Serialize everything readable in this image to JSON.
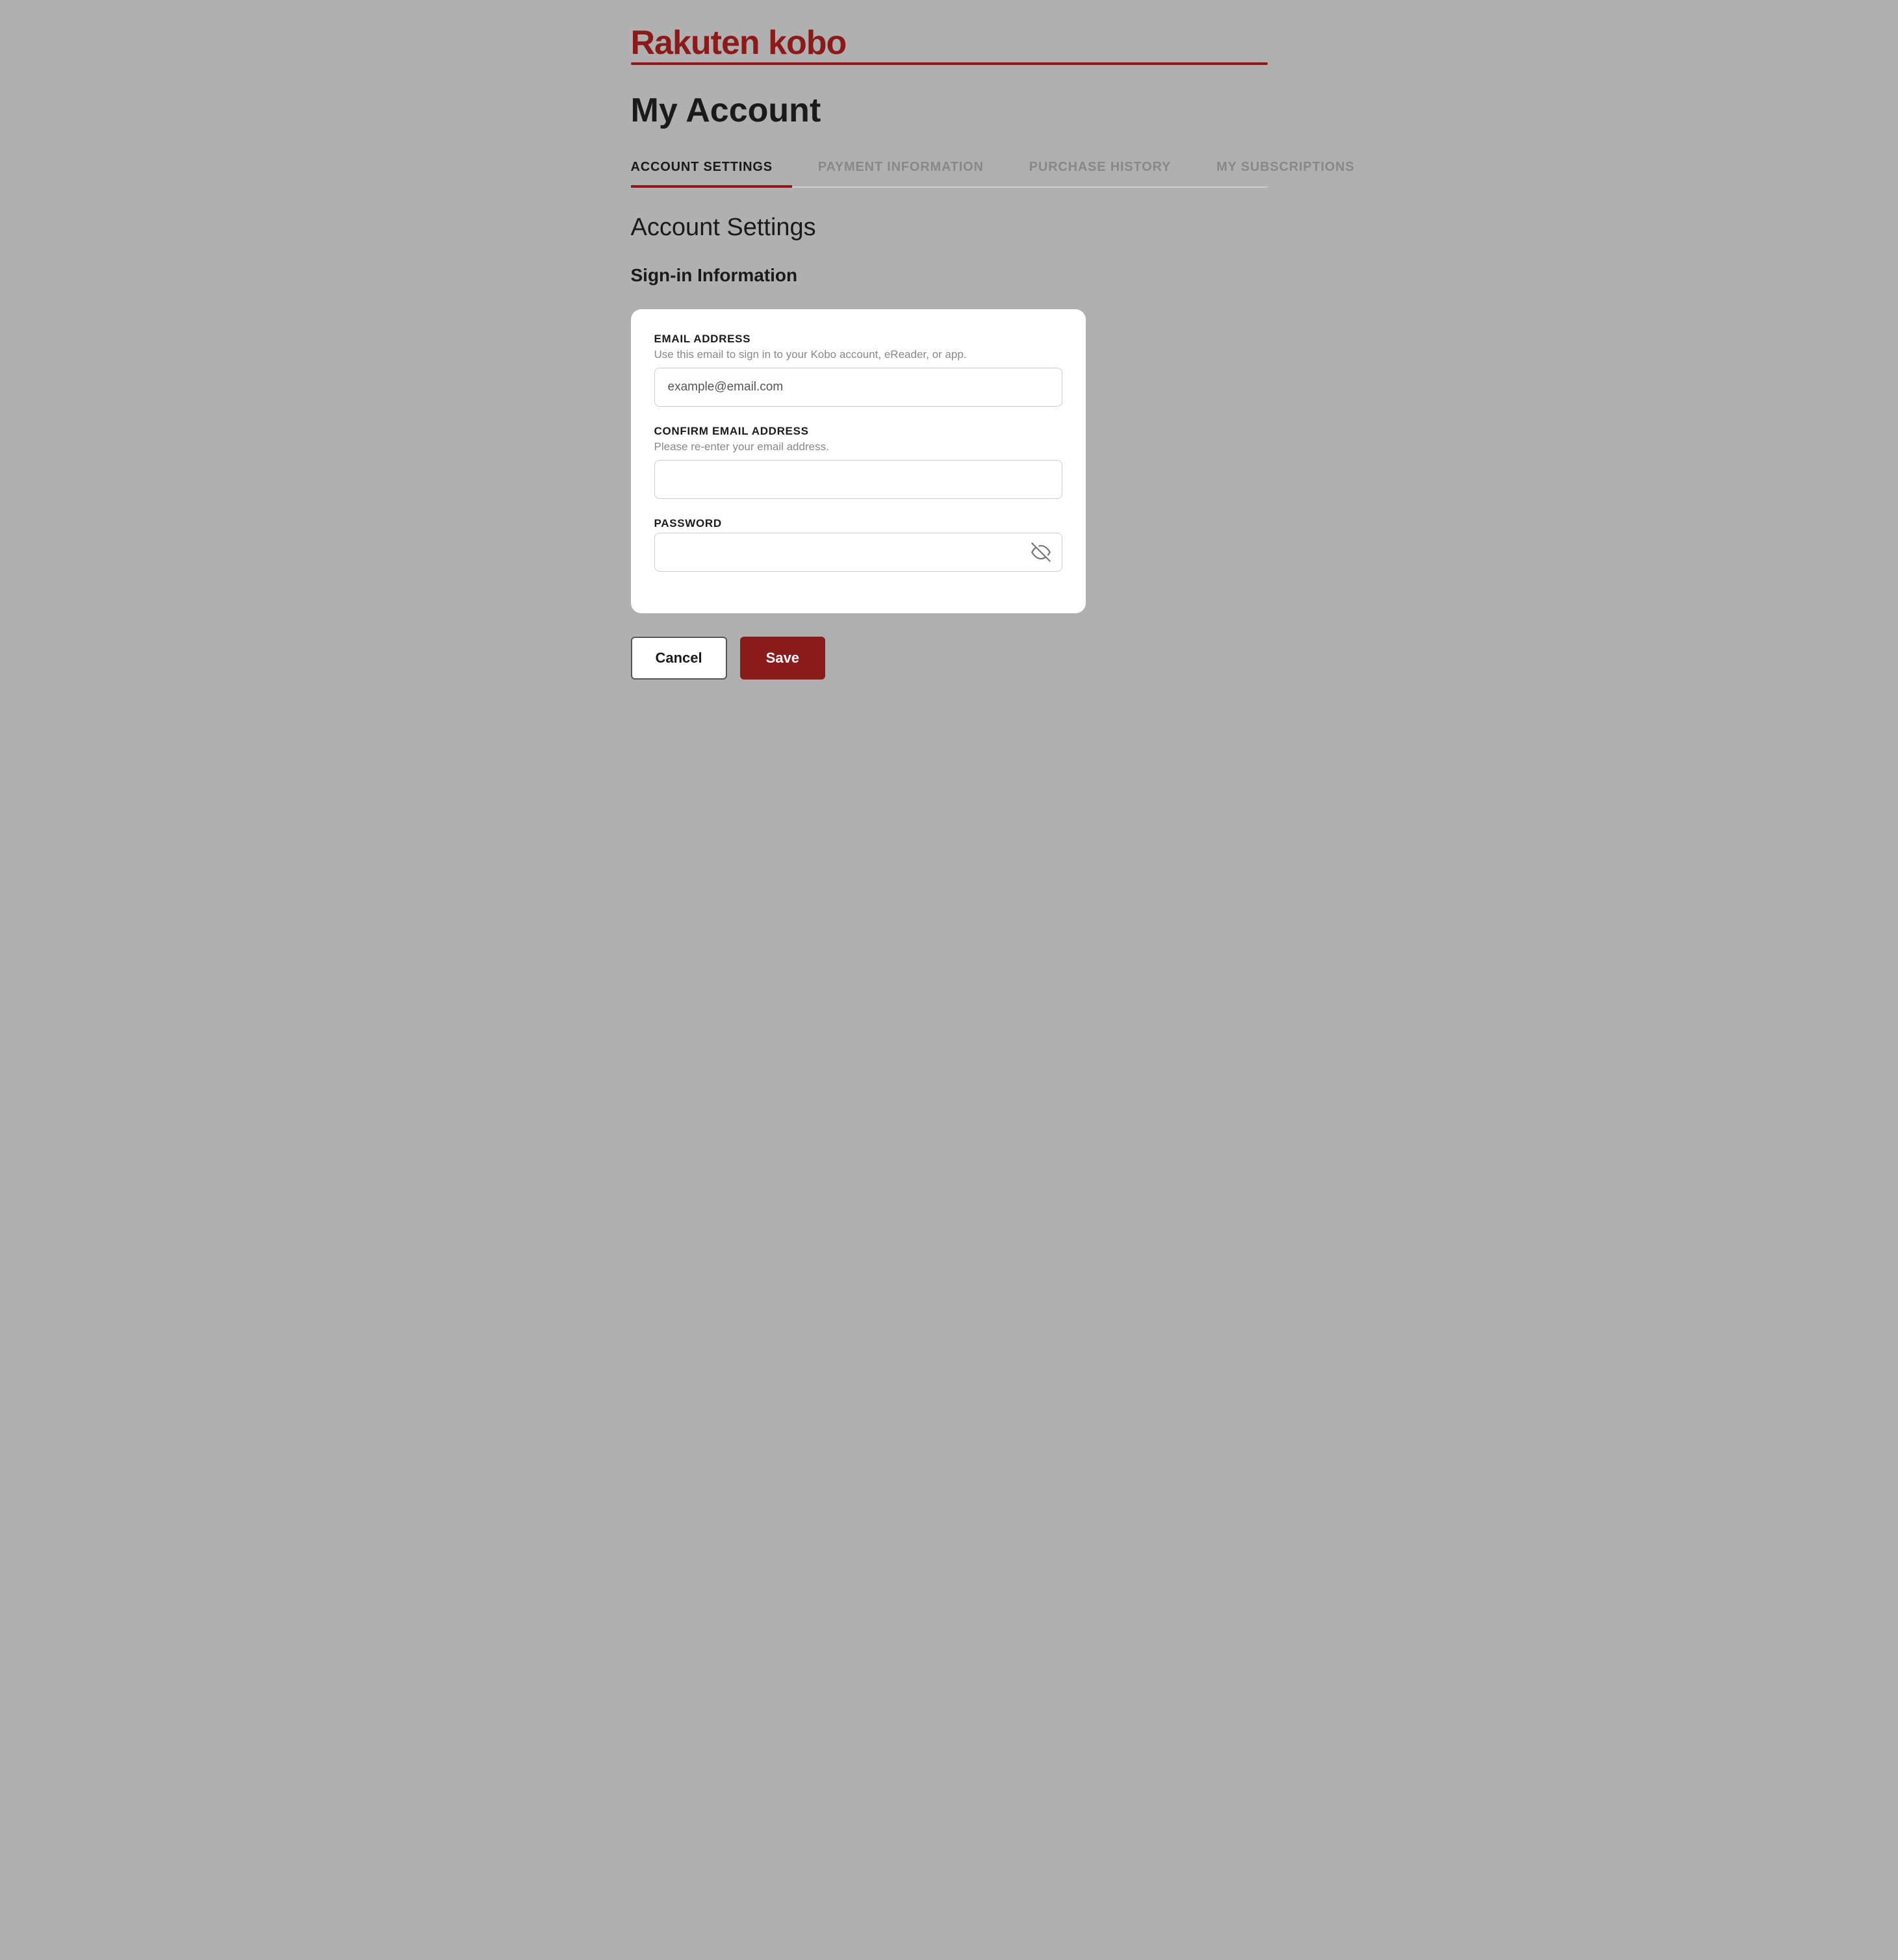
{
  "logo": {
    "text": "Rakuten kobo",
    "rakuten": "Rakuten",
    "kobo": " kobo"
  },
  "page": {
    "title": "My Account"
  },
  "tabs": [
    {
      "id": "account-settings",
      "label": "ACCOUNT SETTINGS",
      "active": true
    },
    {
      "id": "payment-information",
      "label": "PAYMENT INFORMATION",
      "active": false
    },
    {
      "id": "purchase-history",
      "label": "PURCHASE HISTORY",
      "active": false
    },
    {
      "id": "my-subscriptions",
      "label": "MY SUBSCRIPTIONS",
      "active": false
    }
  ],
  "section": {
    "title": "Account Settings",
    "subsection_title": "Sign-in Information"
  },
  "form": {
    "email_label": "EMAIL ADDRESS",
    "email_hint": "Use this email to sign in to your Kobo account, eReader, or app.",
    "email_placeholder": "example@email.com",
    "email_value": "example@email.com",
    "confirm_email_label": "CONFIRM EMAIL ADDRESS",
    "confirm_email_hint": "Please re-enter your email address.",
    "confirm_email_placeholder": "",
    "confirm_email_value": "",
    "password_label": "PASSWORD",
    "password_placeholder": "",
    "password_value": ""
  },
  "buttons": {
    "cancel_label": "Cancel",
    "save_label": "Save"
  },
  "icons": {
    "eye_slash": "eye-slash-icon"
  }
}
